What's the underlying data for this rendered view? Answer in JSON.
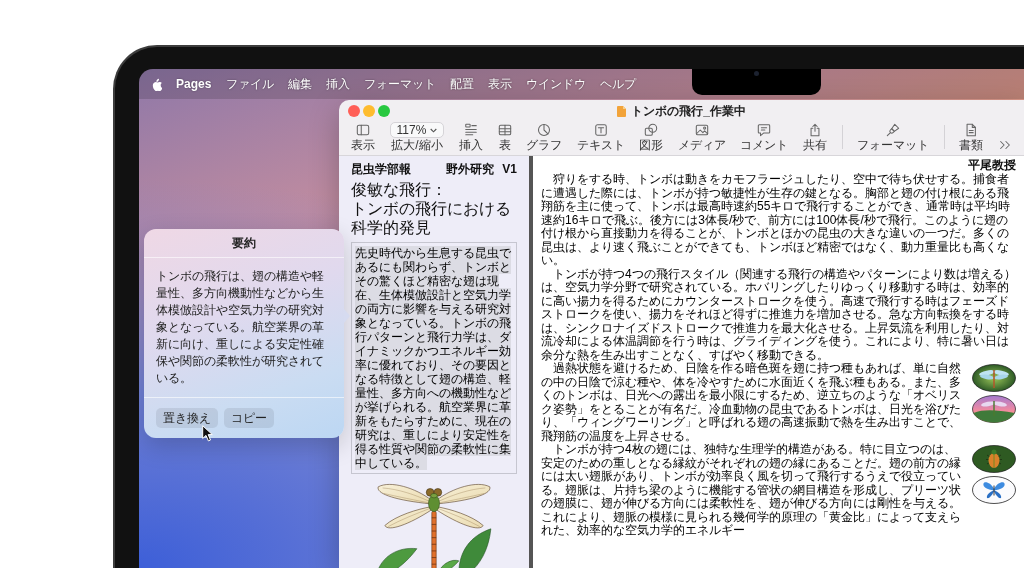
{
  "menu_bar": {
    "app_name": "Pages",
    "menus": [
      "ファイル",
      "編集",
      "挿入",
      "フォーマット",
      "配置",
      "表示",
      "ウインドウ",
      "ヘルプ"
    ]
  },
  "summary_popover": {
    "title": "要約",
    "text": "トンボの飛行は、翅の構造や軽量性、多方向機動性などから生体模倣設計や空気力学の研究対象となっている。航空業界の革新に向け、重しによる安定性確保や関節の柔軟性が研究されている。",
    "buttons": [
      "置き換え",
      "コピー"
    ]
  },
  "window": {
    "title": "トンボの飛行_作業中",
    "toolbar": [
      {
        "kind": "view",
        "label": "表示"
      },
      {
        "kind": "zoom",
        "value": "117%",
        "label": "拡大/縮小"
      },
      {
        "kind": "insert",
        "label": "挿入"
      },
      {
        "kind": "table",
        "label": "表"
      },
      {
        "kind": "chart",
        "label": "グラフ"
      },
      {
        "kind": "text",
        "label": "テキスト"
      },
      {
        "kind": "shape",
        "label": "図形"
      },
      {
        "kind": "media",
        "label": "メディア"
      },
      {
        "kind": "comment",
        "label": "コメント"
      },
      {
        "kind": "share",
        "label": "共有"
      },
      {
        "kind": "format",
        "label": "フォーマット"
      },
      {
        "kind": "document",
        "label": "書類"
      },
      {
        "kind": "more"
      }
    ]
  },
  "document": {
    "pages": [
      {
        "header": [
          "昆虫学部報",
          "野外研究",
          "V1"
        ],
        "title_lines": [
          "俊敏な飛行：",
          "トンボの飛行における",
          "科学的発見"
        ],
        "paragraphs": [
          {
            "text": "先史時代から生息する昆虫であるにも関わらず、トンボとその驚くほど精密な翅は現在、生体模倣設計と空気力学の両方に影響を与える研究対象となっている。トンボの飛行パターンと飛行力学は、ダイナミックかつエネルギー効率に優れており、その要因となる特徴として翅の構造、軽量性、多方向への機動性などが挙げられる。航空業界に革新をもたらすために、現在の研究は、重しにより安定性を得る性質や関節の柔軟性に集中している。",
            "selected": true
          }
        ]
      },
      {
        "header": [
          "平尾教授"
        ],
        "paragraphs": [
          {
            "text": "狩りをする時、トンボは動きをカモフラージュしたり、空中で待ち伏せする。捕食者に遭遇した際には、トンボが持つ敏捷性が生存の鍵となる。胸部と翅の付け根にある飛翔筋を主に使って、トンボは最高時速約55キロで飛行することができ、通常時は平均時速約16キロで飛ぶ。後方には3体長/秒で、前方には100体長/秒で飛行。このように翅の付け根から直接動力を得ることが、トンボとほかの昆虫の大きな違いの一つだ。多くの昆虫は、より速く飛ぶことができても、トンボほど精密ではなく、動力重量比も高くない。",
            "selected": false
          },
          {
            "text": "トンボが持つ4つの飛行スタイル（関連する飛行の構造やパターンにより数は増える）は、空気力学分野で研究されている。ホバリングしたりゆっくり移動する時は、効率的に高い揚力を得るためにカウンターストロークを使う。高速で飛行する時はフェーズドストロークを使い、揚力をそれほど得ずに推進力を増加させる。急な方向転換をする時は、シンクロナイズドストロークで推進力を最大化させる。上昇気流を利用したり、対流冷却による体温調節を行う時は、グライディングを使う。これにより、特に暑い日は余分な熱を生み出すことなく、すばやく移動できる。",
            "selected": false
          },
          {
            "text": "過熱状態を避けるため、日陰を作る暗色斑を翅に持つ種もあれば、単に自然の中の日陰で涼む種や、体を冷やすために水面近くを飛ぶ種もある。また、多くのトンボは、日光への露出を最小限にするため、逆立ちのような「オベリスク姿勢」をとることが有名だ。冷血動物の昆虫であるトンボは、日光を浴びたり、「ウィングワーリング」と呼ばれる翅の高速振動で熱を生み出すことで、飛翔筋の温度を上昇させる。",
            "selected": false
          },
          {
            "text": "トンボが持つ4枚の翅には、独特な生理学的構造がある。特に目立つのは、安定のための重しとなる縁紋がそれぞれの翅の縁にあることだ。翅の前方の縁には太い翅脈があり、トンボが効率良く風を切って飛行するうえで役立っている。翅脈は、片持ち梁のように機能する管状の網目構造を形成し、プリーツ状の翅膜に、翅が伸びる方向には柔軟性を、翅が伸びる方向には剛性を与える。これにより、翅脈の模様に見られる幾何学的原理の「黄金比」によって支えられた、効率的な空気力学的エネルギー",
            "selected": false
          }
        ]
      }
    ]
  }
}
